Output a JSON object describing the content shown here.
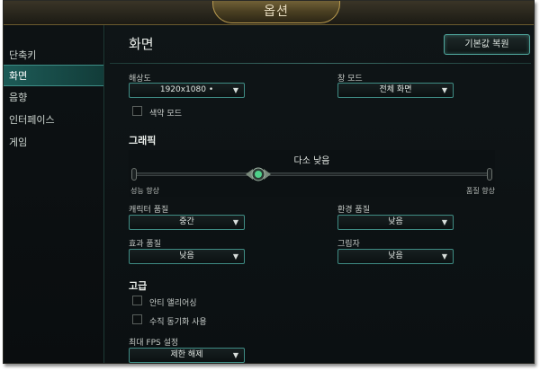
{
  "window": {
    "title": "옵션"
  },
  "sidebar": {
    "items": [
      {
        "label": "단축키"
      },
      {
        "label": "화면"
      },
      {
        "label": "음향"
      },
      {
        "label": "인터페이스"
      },
      {
        "label": "게임"
      }
    ],
    "selected": "화면"
  },
  "main": {
    "title": "화면",
    "reset_label": "기본값 복원",
    "resolution": {
      "label": "해상도",
      "value": "1920x1080 •"
    },
    "window_mode": {
      "label": "창 모드",
      "value": "전체 화면"
    },
    "colorblind": {
      "label": "색약 모드",
      "checked": false
    },
    "graphics": {
      "title": "그래픽",
      "slider": {
        "value_label": "다소 낮음",
        "min_label": "성능 향상",
        "max_label": "품질 향상",
        "level": 0.35
      },
      "character_quality": {
        "label": "캐릭터 품질",
        "value": "중간"
      },
      "environment_quality": {
        "label": "환경 품질",
        "value": "낮음"
      },
      "effects_quality": {
        "label": "효과 품질",
        "value": "낮음"
      },
      "shadows": {
        "label": "그림자",
        "value": "낮음"
      }
    },
    "advanced": {
      "title": "고급",
      "anti_aliasing": {
        "label": "안티 앨리어싱",
        "checked": false
      },
      "vsync": {
        "label": "수직 동기화 사용",
        "checked": false
      },
      "fps_cap": {
        "label": "최대 FPS 설정",
        "value": "제한 해제"
      }
    }
  },
  "colors": {
    "accent": "#4fa59b",
    "selected_bg": "#1d5b57",
    "title_gold": "#b89a4f"
  },
  "icons": {
    "dropdown": "chevron-down-icon",
    "slider_knob": "gem-knob-icon"
  }
}
